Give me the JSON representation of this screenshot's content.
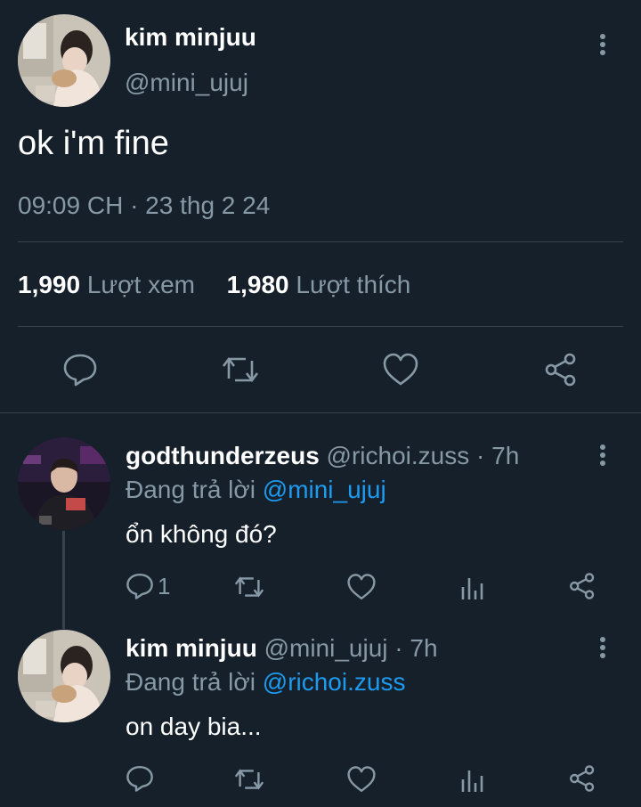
{
  "colors": {
    "background": "#15202b",
    "muted": "#8899a6",
    "link": "#1d9bf0",
    "divider": "#38444d"
  },
  "main_tweet": {
    "author_name": "kim minjuu",
    "author_handle": "@mini_ujuj",
    "text": "ok i'm fine",
    "timestamp": "09:09 CH · 23 thg 2 24",
    "views_count": "1,990",
    "views_label": "Lượt xem",
    "likes_count": "1,980",
    "likes_label": "Lượt thích",
    "actions": [
      "reply-icon",
      "retweet-icon",
      "like-icon",
      "share-icon"
    ]
  },
  "replies": [
    {
      "author_name": "godthunderzeus",
      "author_handle": "@richoi.zuss",
      "time": "· 7h",
      "replying_prefix": "Đang trả lời",
      "replying_to": "@mini_ujuj",
      "text": "ổn không đó?",
      "reply_count": "1"
    },
    {
      "author_name": "kim minjuu",
      "author_handle": "@mini_ujuj",
      "time": "· 7h",
      "replying_prefix": "Đang trả lời",
      "replying_to": "@richoi.zuss",
      "text": "on day bia...",
      "reply_count": ""
    }
  ]
}
